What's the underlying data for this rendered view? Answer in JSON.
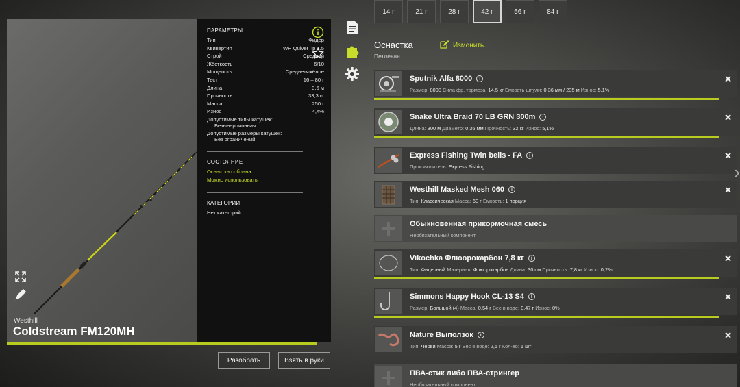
{
  "weights": [
    "14 г",
    "21 г",
    "28 г",
    "42 г",
    "56 г",
    "84 г"
  ],
  "active_weight_index": 3,
  "rod": {
    "brand": "Westhill",
    "name": "Coldstream FM120MH",
    "params_header": "ПАРАМЕТРЫ",
    "params": [
      {
        "k": "Тип",
        "v": "Фидер"
      },
      {
        "k": "Квивертип",
        "v": "WH QuiverTip 1.5"
      },
      {
        "k": "Строй",
        "v": "Средний"
      },
      {
        "k": "Жёсткость",
        "v": "6/10"
      },
      {
        "k": "Мощность",
        "v": "Среднетяжёлое"
      },
      {
        "k": "Тест",
        "v": "16 – 80 г"
      },
      {
        "k": "Длина",
        "v": "3,6 м"
      },
      {
        "k": "Прочность",
        "v": "33,3 кг"
      },
      {
        "k": "Масса",
        "v": "250 г"
      },
      {
        "k": "Износ",
        "v": "4,4%"
      }
    ],
    "reel_types_label": "Допустимые типы катушек:",
    "reel_types_value": "Безынерционная",
    "reel_sizes_label": "Допустимые размеры катушек:",
    "reel_sizes_value": "Без ограничений",
    "state_header": "СОСТОЯНИЕ",
    "state_1": "Оснастка собрана",
    "state_2": "Можно использовать",
    "cat_header": "КАТЕГОРИИ",
    "cat_value": "Нет категорий",
    "wear_fraction": 1.0
  },
  "buttons": {
    "disassemble": "Разобрать",
    "take": "Взять в руки"
  },
  "rig": {
    "title": "Оснастка",
    "subtitle": "Петлевая",
    "edit": "Изменить..."
  },
  "slots": [
    {
      "name": "Sputnik Alfa 8000",
      "info": [
        [
          "Размер:",
          "8000"
        ],
        [
          "Сила фр. тормоза:",
          "14,5 кг"
        ],
        [
          "Ёмкость шпули:",
          "0,36 мм / 235 м"
        ],
        [
          "Износ:",
          "5,1%"
        ]
      ]
    },
    {
      "name": "Snake Ultra Braid 70 LB GRN 300m",
      "info": [
        [
          "Длина:",
          "300 м"
        ],
        [
          "Диаметр:",
          "0,36 мм"
        ],
        [
          "Прочность:",
          "32 кг"
        ],
        [
          "Износ:",
          "5,1%"
        ]
      ]
    },
    {
      "name": "Express Fishing Twin bells - FA",
      "info": [
        [
          "Производитель:",
          "Express Fishing"
        ]
      ]
    },
    {
      "name": "Westhill Masked Mesh 060",
      "info": [
        [
          "Тип:",
          "Классическая"
        ],
        [
          "Масса:",
          "60 г"
        ],
        [
          "Ёмкость:",
          "1 порция"
        ]
      ]
    },
    {
      "name": "Обыкновенная прикормочная смесь",
      "info": [
        [
          "Необязательный компонент",
          ""
        ]
      ]
    },
    {
      "name": "Vikochka Флюорокарбон 7,8 кг",
      "info": [
        [
          "Тип:",
          "Фидерный"
        ],
        [
          "Материал:",
          "Флюорокарбон"
        ],
        [
          "Длина:",
          "30 см"
        ],
        [
          "Прочность:",
          "7,8 кг"
        ],
        [
          "Износ:",
          "0,2%"
        ]
      ]
    },
    {
      "name": "Simmons Happy Hook CL-13 S4",
      "info": [
        [
          "Размер:",
          "Большой (4)"
        ],
        [
          "Масса:",
          "0,54 г"
        ],
        [
          "Вес в воде:",
          "0,47 г"
        ],
        [
          "Износ:",
          "0%"
        ]
      ]
    },
    {
      "name": "Nature Выползок",
      "info": [
        [
          "Тип:",
          "Черви"
        ],
        [
          "Масса:",
          "5 г"
        ],
        [
          "Вес в воде:",
          "2,5 г"
        ],
        [
          "Кол-во:",
          "1 шт"
        ]
      ]
    },
    {
      "name": "ПВА-стик либо ПВА-стрингер",
      "info": [
        [
          "Необязательный компонент",
          ""
        ]
      ]
    }
  ],
  "colors": {
    "accent": "#b8cc1f",
    "green_text": "#c8dc2a",
    "panel": "#111111"
  }
}
